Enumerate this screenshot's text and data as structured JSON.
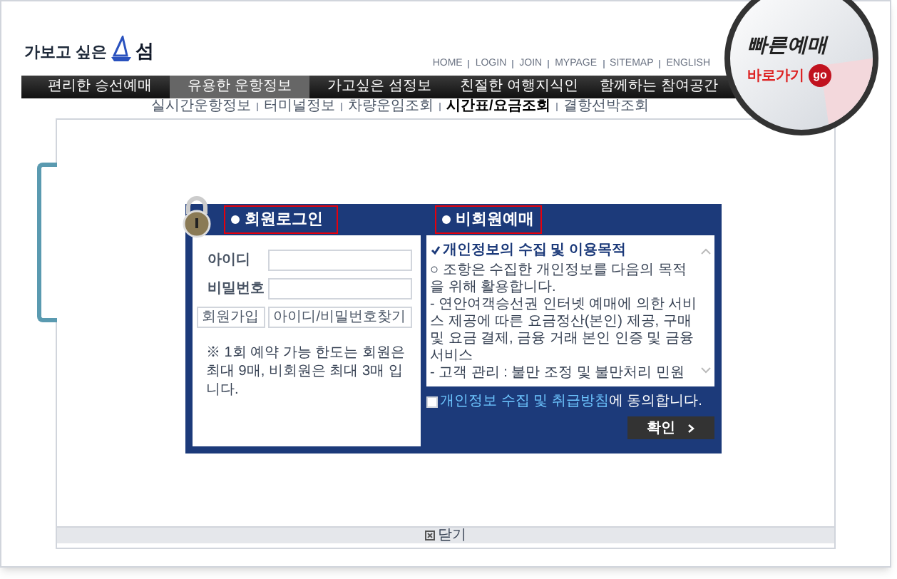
{
  "header": {
    "logo_text": "가보고 싶은",
    "logo_mark": "섬",
    "top_links": [
      "HOME",
      "LOGIN",
      "JOIN",
      "MYPAGE",
      "SITEMAP",
      "ENGLISH"
    ]
  },
  "quick_booking": {
    "title": "빠른예매",
    "link": "바로가기",
    "go": "go"
  },
  "nav": [
    {
      "label": "편리한 승선예매",
      "selected": false
    },
    {
      "label": "유용한 운항정보",
      "selected": true
    },
    {
      "label": "가고싶은 섬정보",
      "selected": false
    },
    {
      "label": "친절한 여행지식인",
      "selected": false
    },
    {
      "label": "함께하는 참여공간",
      "selected": false
    }
  ],
  "sub_nav": [
    {
      "label": "실시간운항정보",
      "selected": false
    },
    {
      "label": "터미널정보",
      "selected": false
    },
    {
      "label": "차량운임조회",
      "selected": false
    },
    {
      "label": "시간표/요금조회",
      "selected": true
    },
    {
      "label": "결항선박조회",
      "selected": false
    }
  ],
  "login": {
    "title": "회원로그인",
    "fields": [
      {
        "label": "아이디"
      },
      {
        "label": "비밀번호"
      }
    ],
    "buttons": [
      "회원가입",
      "아이디/비밀번호찾기"
    ],
    "notice": "※ 1회 예약 가능 한도는 회원은 최대 9매, 비회원은 최대 3매 입니다."
  },
  "guest": {
    "title": "비회원예매",
    "terms_heading": "개인정보의 수집 및 이용목적",
    "terms": [
      "○ 조항은 수집한 개인정보를 다음의 목적을 위해 활용합니다.",
      "- 연안여객승선권 인터넷 예매에 의한 서비스 제공에 따른 요금정산(본인) 제공, 구매 및 요금 결제, 금융 거래 본인 인증 및 금융 서비스",
      "- 고객 관리 : 불만 조정 및 불만처리 민원"
    ],
    "agree_checked": false,
    "agree_link": "개인정보 수집 및 취급방침",
    "agree_text": "에 동의합니다.",
    "confirm": "확인"
  },
  "close_button": "닫기"
}
